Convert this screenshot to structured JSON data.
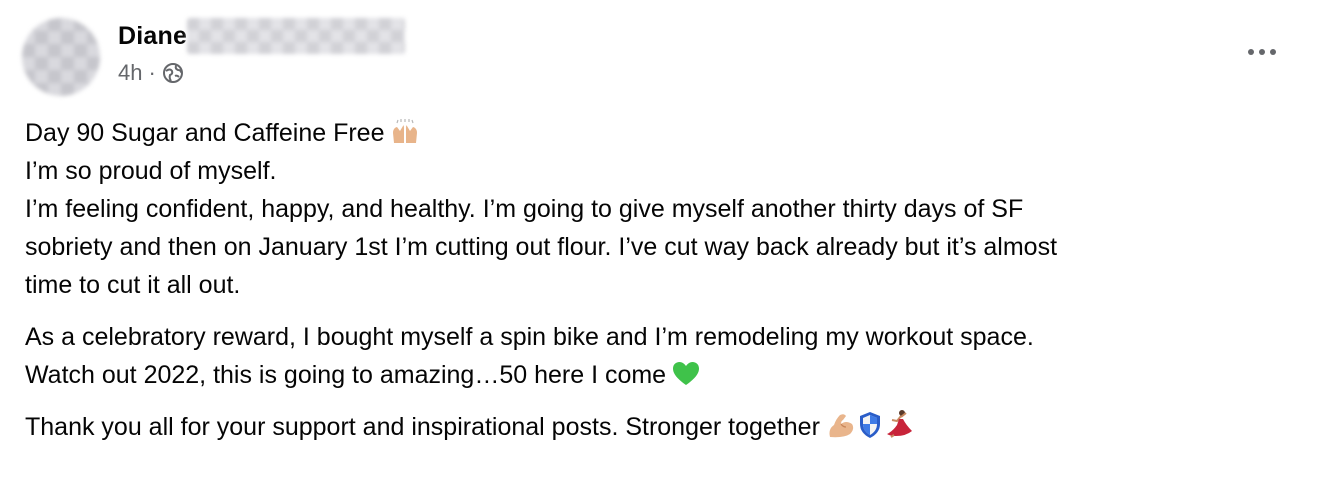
{
  "post": {
    "author_name": "Diane",
    "author_surname_redacted": true,
    "time": "4h",
    "separator": "·",
    "privacy_icon": "public-globe-icon",
    "more_icon": "more-options-icon",
    "lines": [
      "Day 90 Sugar and Caffeine Free",
      "I’m so proud of myself.",
      "I’m feeling confident, happy, and healthy. I’m going to give myself another thirty days of SF",
      "sobriety and then on January 1st I’m cutting out flour.  I’ve cut way back already but it’s almost",
      "time to cut it all out.",
      "As a celebratory reward, I bought myself a spin bike and I’m remodeling my workout space.",
      "Watch out 2022, this is going to amazing…50 here I come",
      "Thank you all for your support and inspirational posts. Stronger together"
    ],
    "emojis": {
      "line1": "raising-hands-emoji",
      "line7": "green-heart-emoji",
      "line8": [
        "flexed-biceps-emoji",
        "shield-emoji",
        "dancer-emoji"
      ]
    },
    "colors": {
      "text": "#050505",
      "meta": "#65676b",
      "green_heart": "#3fc24a"
    }
  }
}
